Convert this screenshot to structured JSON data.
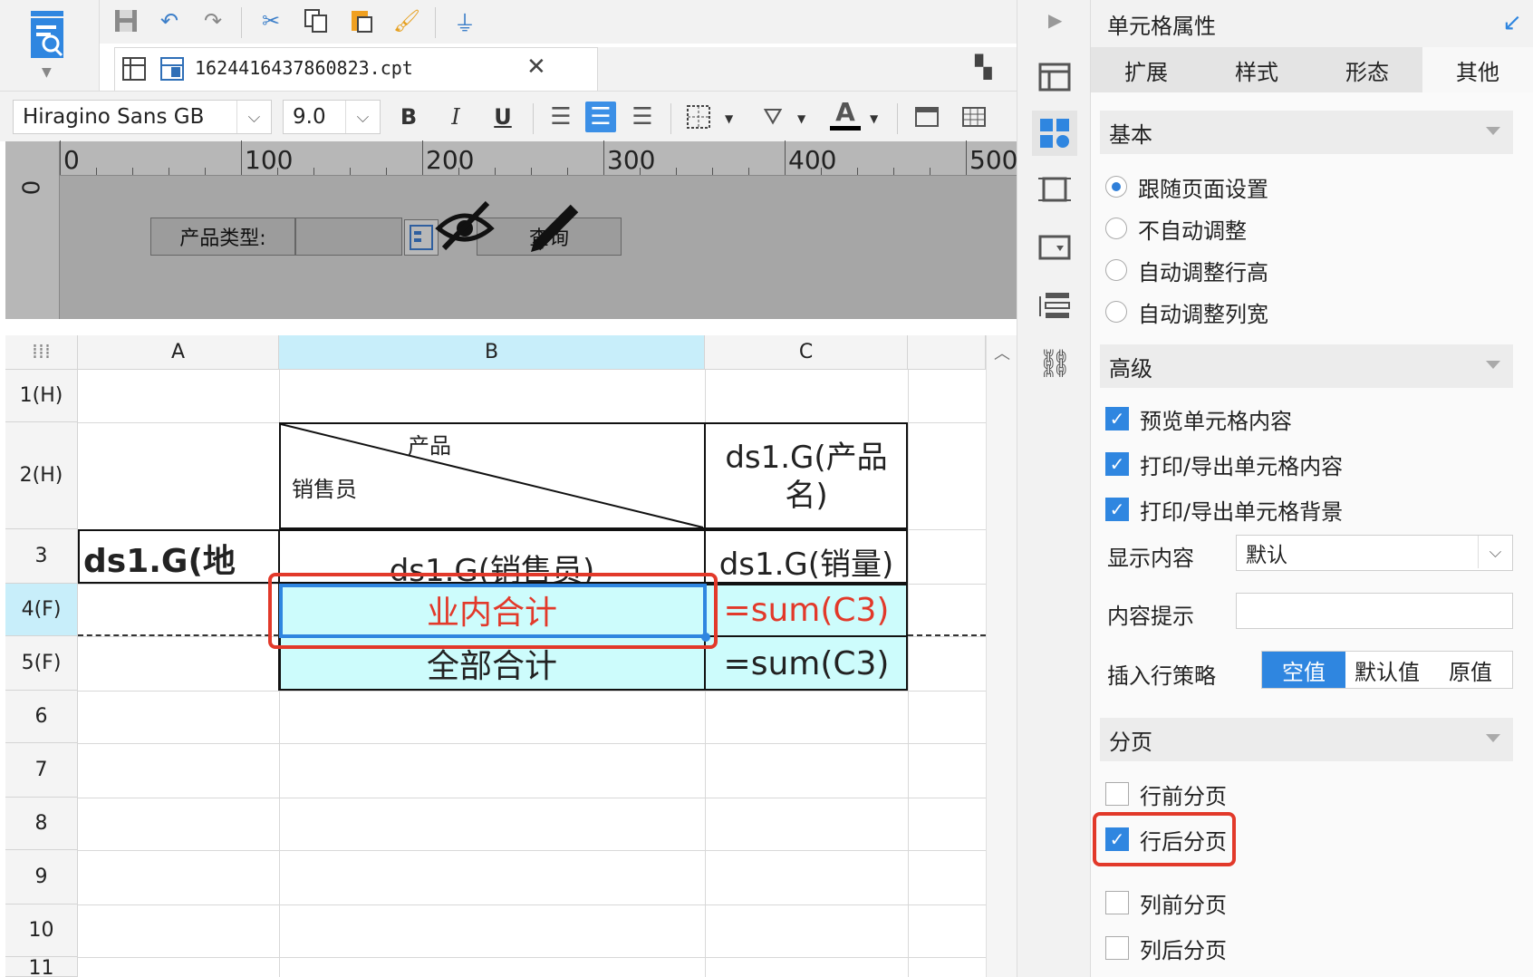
{
  "toolbar": {
    "tab_file": "1624416437860823.cpt",
    "font_name": "Hiragino Sans GB",
    "font_size": "9.0",
    "bold": "B",
    "italic": "I",
    "underline": "U"
  },
  "ruler": {
    "numbers": [
      "0",
      "100",
      "200",
      "300",
      "400",
      "500"
    ],
    "left_number": "0"
  },
  "form": {
    "label": "产品类型:",
    "query_button": "查询"
  },
  "sheet": {
    "columns": [
      "A",
      "B",
      "C"
    ],
    "rows": [
      "1(H)",
      "2(H)",
      "3",
      "4(F)",
      "5(F)",
      "6",
      "7",
      "8",
      "9",
      "10",
      "11"
    ],
    "cells": {
      "B2_top": "产品",
      "B2_bottom": "销售员",
      "C2": "ds1.G(产品名)",
      "A3": "ds1.G(地",
      "B3": "ds1.G(销售员)",
      "C3": "ds1.G(销量)",
      "B4": "业内合计",
      "C4": "=sum(C3)",
      "B5": "全部合计",
      "C5": "=sum(C3)"
    }
  },
  "panel": {
    "title": "单元格属性",
    "tabs": [
      "扩展",
      "样式",
      "形态",
      "其他"
    ],
    "section_basic": "基本",
    "basic_options": [
      "跟随页面设置",
      "不自动调整",
      "自动调整行高",
      "自动调整列宽"
    ],
    "section_advanced": "高级",
    "advanced_checks": [
      "预览单元格内容",
      "打印/导出单元格内容",
      "打印/导出单元格背景"
    ],
    "display_label": "显示内容",
    "display_value": "默认",
    "tooltip_label": "内容提示",
    "insert_label": "插入行策略",
    "insert_options": [
      "空值",
      "默认值",
      "原值"
    ],
    "section_page": "分页",
    "page_checks": [
      "行前分页",
      "行后分页",
      "列前分页",
      "列后分页"
    ]
  },
  "colors": {
    "accent": "#2f86e0",
    "highlight_red": "#e2392a",
    "selected_cell_bg": "#cdfcfc",
    "column_b_header": "#c8eefa"
  }
}
